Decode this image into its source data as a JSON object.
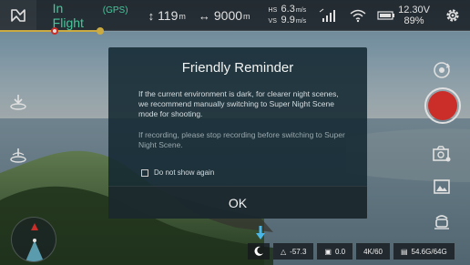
{
  "status": {
    "flight_mode": "In Flight",
    "positioning": "(GPS)",
    "altitude": {
      "value": "119",
      "unit": "m"
    },
    "distance": {
      "value": "9000",
      "unit": "m"
    },
    "speeds": [
      {
        "label": "HS",
        "value": "6.3",
        "unit": "m/s"
      },
      {
        "label": "VS",
        "value": "9.9",
        "unit": "m/s"
      }
    ],
    "battery": {
      "voltage": "12.30V",
      "percent": "89%"
    }
  },
  "modal": {
    "title": "Friendly Reminder",
    "message": "If the current environment is dark, for clearer night scenes, we recommend manually switching to Super Night Scene mode for shooting.",
    "secondary": "If recording, please stop recording before switching to Super Night Scene.",
    "checkbox_label": "Do not show again",
    "ok_label": "OK"
  },
  "bottom": {
    "ev": "-57.3",
    "exposure": "0.0",
    "resolution": "4K/60",
    "storage": "54.6G/64G"
  },
  "colors": {
    "accent": "#4fe3b0",
    "record": "#e8352e",
    "progress": "#e8c34a"
  },
  "icons": [
    "home-icon",
    "altitude-icon",
    "distance-icon",
    "signal-icon",
    "wifi-icon",
    "battery-icon",
    "gear-icon",
    "takeoff-icon",
    "land-icon",
    "rotate-camera-icon",
    "photo-mode-icon",
    "gallery-icon",
    "pilot-icon",
    "night-mode-icon",
    "down-arrow-icon",
    "ev-icon",
    "exposure-icon",
    "sd-card-icon"
  ]
}
